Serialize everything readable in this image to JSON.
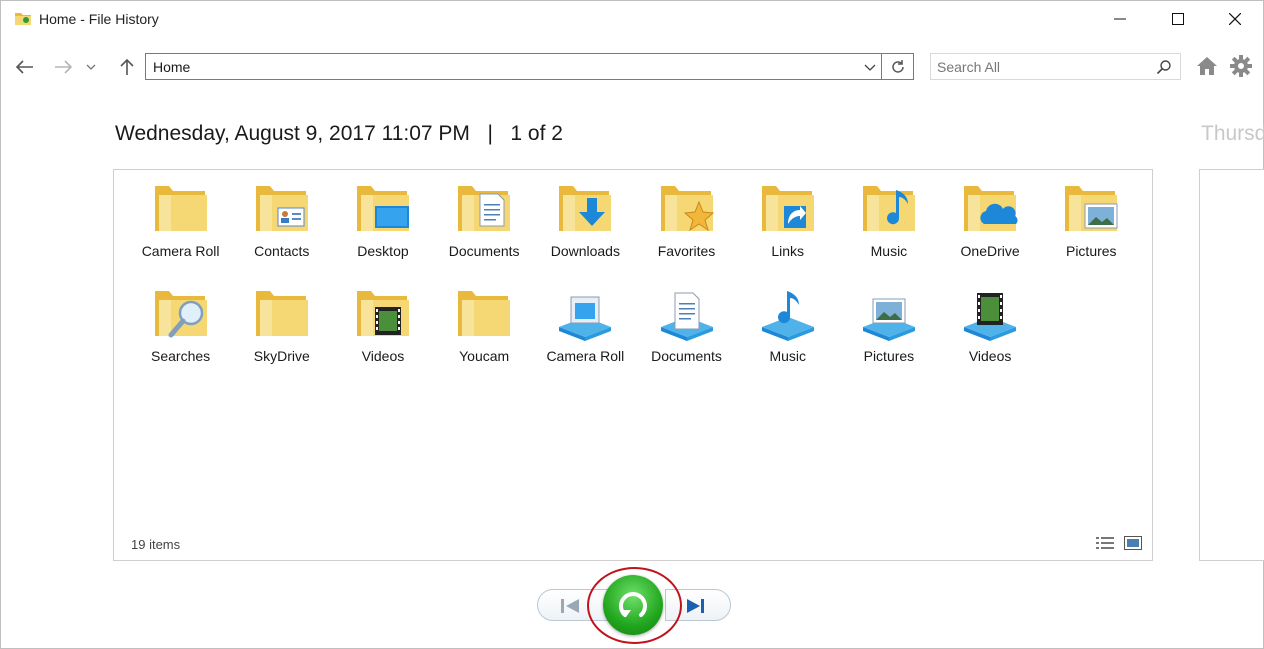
{
  "window": {
    "title": "Home - File History"
  },
  "nav": {
    "address": "Home",
    "search_placeholder": "Search All"
  },
  "header": {
    "date_text": "Wednesday, August 9, 2017 11:07 PM",
    "separator": "|",
    "page_text": "1 of 2",
    "next_date_text": "Thursd"
  },
  "items": [
    {
      "label": "Camera Roll",
      "icon": "camera-roll-folder-icon",
      "kind": "folder"
    },
    {
      "label": "Contacts",
      "icon": "contacts-folder-icon",
      "kind": "folder"
    },
    {
      "label": "Desktop",
      "icon": "desktop-folder-icon",
      "kind": "folder"
    },
    {
      "label": "Documents",
      "icon": "documents-folder-icon",
      "kind": "folder"
    },
    {
      "label": "Downloads",
      "icon": "downloads-folder-icon",
      "kind": "folder"
    },
    {
      "label": "Favorites",
      "icon": "favorites-folder-icon",
      "kind": "folder"
    },
    {
      "label": "Links",
      "icon": "links-folder-icon",
      "kind": "folder"
    },
    {
      "label": "Music",
      "icon": "music-folder-icon",
      "kind": "folder"
    },
    {
      "label": "OneDrive",
      "icon": "onedrive-folder-icon",
      "kind": "folder"
    },
    {
      "label": "Pictures",
      "icon": "pictures-folder-icon",
      "kind": "folder"
    },
    {
      "label": "Searches",
      "icon": "searches-folder-icon",
      "kind": "folder"
    },
    {
      "label": "SkyDrive",
      "icon": "skydrive-folder-icon",
      "kind": "folder"
    },
    {
      "label": "Videos",
      "icon": "videos-folder-icon",
      "kind": "folder"
    },
    {
      "label": "Youcam",
      "icon": "youcam-folder-icon",
      "kind": "folder"
    },
    {
      "label": "Camera Roll",
      "icon": "camera-roll-library-icon",
      "kind": "library"
    },
    {
      "label": "Documents",
      "icon": "documents-library-icon",
      "kind": "library"
    },
    {
      "label": "Music",
      "icon": "music-library-icon",
      "kind": "library"
    },
    {
      "label": "Pictures",
      "icon": "pictures-library-icon",
      "kind": "library"
    },
    {
      "label": "Videos",
      "icon": "videos-library-icon",
      "kind": "library"
    }
  ],
  "status": {
    "count_text": "19 items"
  },
  "colors": {
    "folder": "#f5d774",
    "folder_dark": "#e8b93c",
    "accent_blue": "#1e88d8",
    "restore_green": "#21a61e",
    "highlight_red": "#c0141c"
  }
}
